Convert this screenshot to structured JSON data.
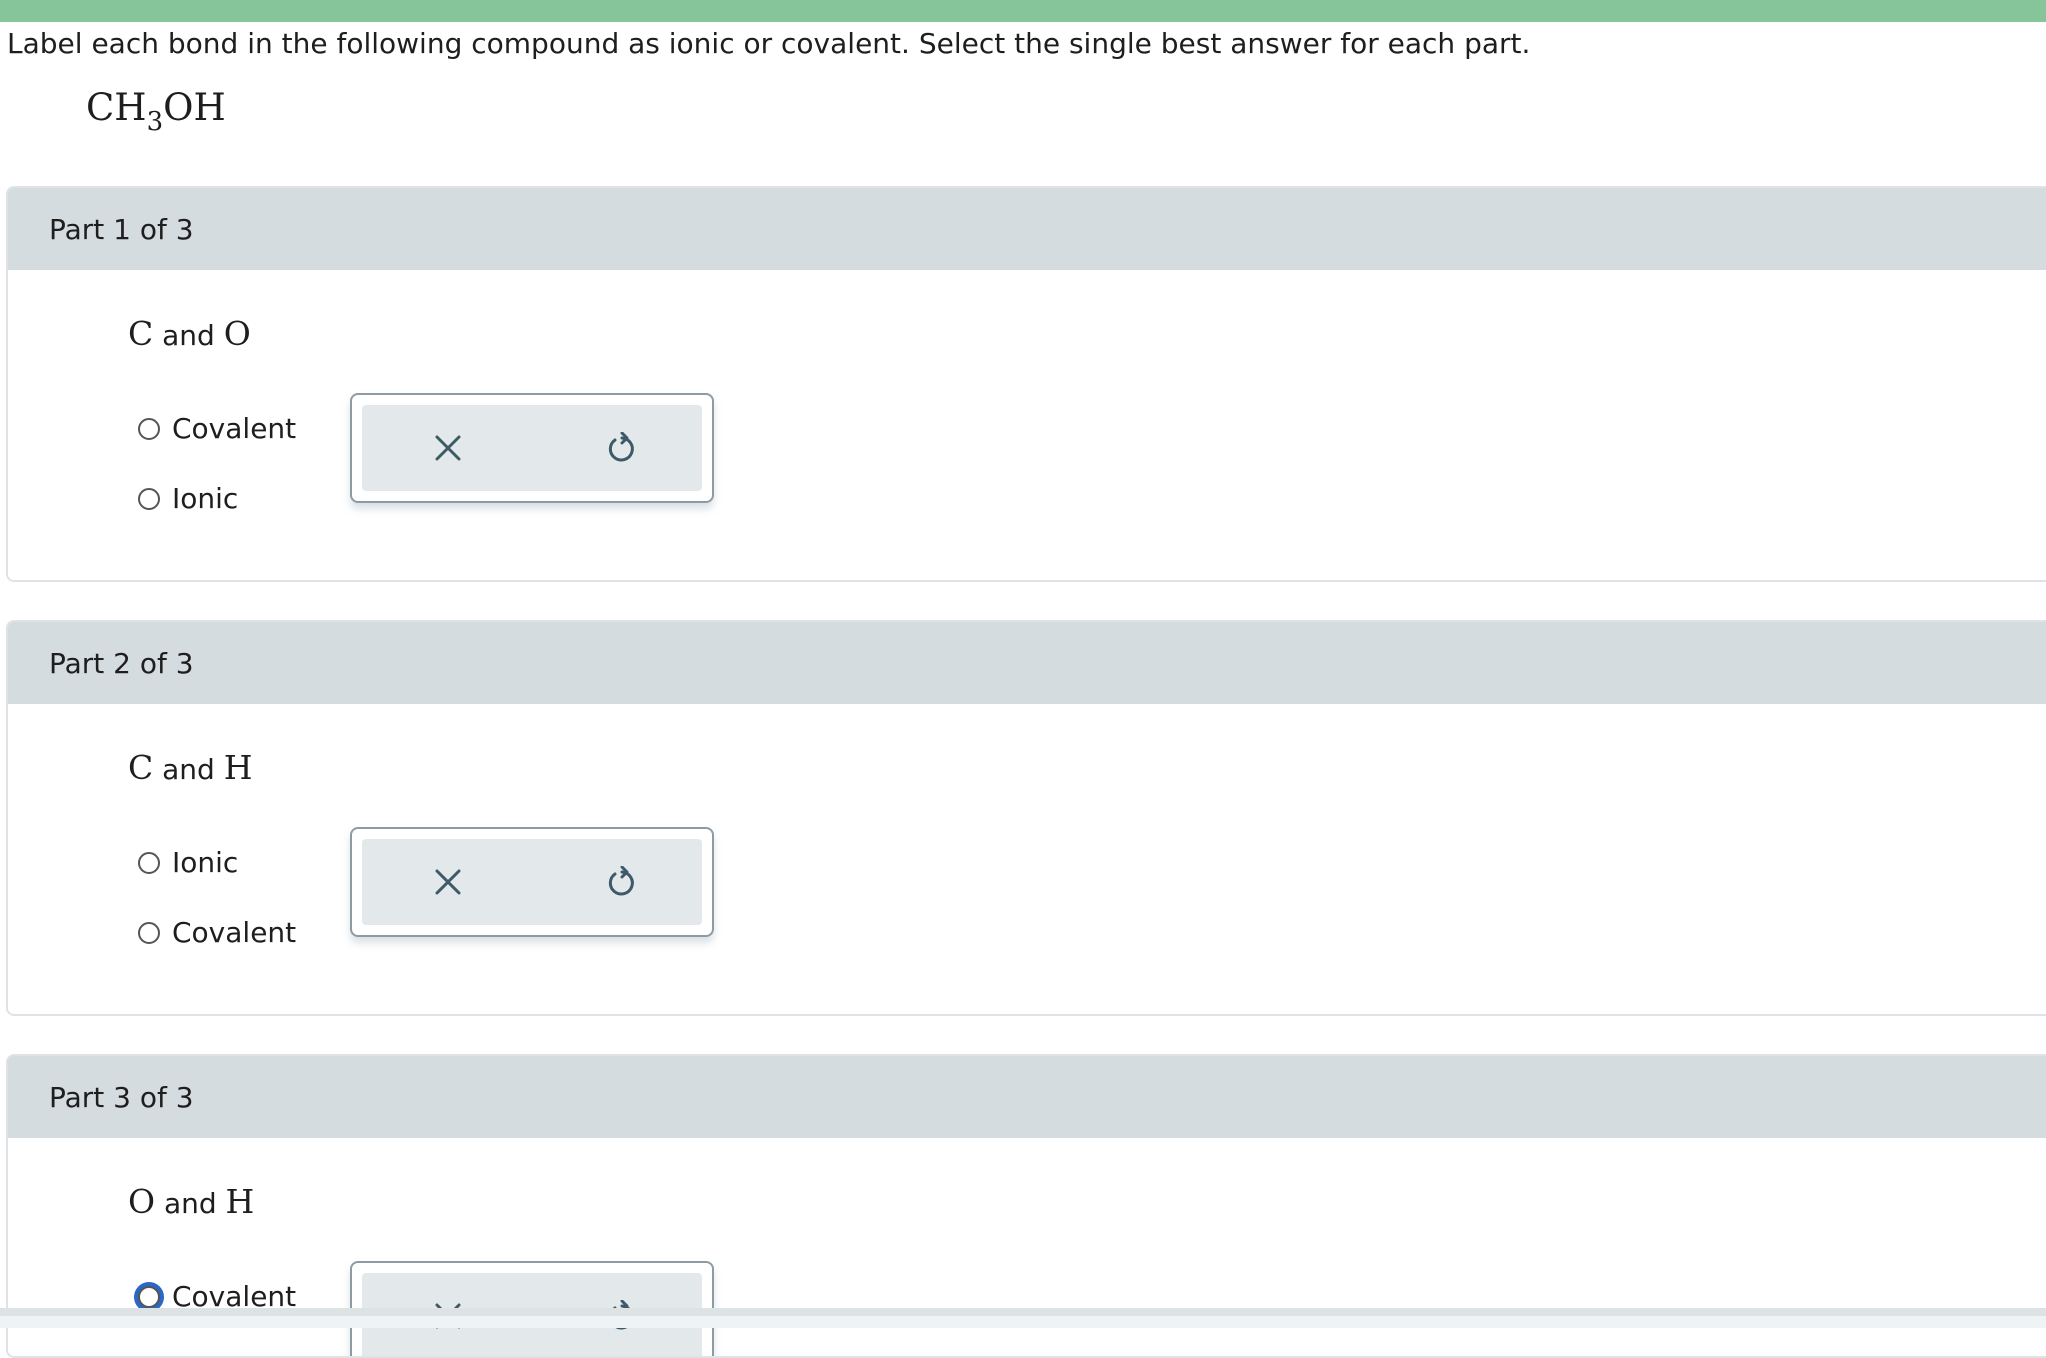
{
  "prompt": "Label each bond in the following compound as ionic or covalent. Select the single best answer for each part.",
  "formula": {
    "main": "CH",
    "subscript": "3",
    "tail": "OH"
  },
  "parts": [
    {
      "header": "Part 1 of 3",
      "question": {
        "el1": "C",
        "and": " and ",
        "el2": "O"
      },
      "options": [
        "Covalent",
        "Ionic"
      ]
    },
    {
      "header": "Part 2 of 3",
      "question": {
        "el1": "C",
        "and": " and ",
        "el2": "H"
      },
      "options": [
        "Ionic",
        "Covalent"
      ]
    },
    {
      "header": "Part 3 of 3",
      "question": {
        "el1": "O",
        "and": " and ",
        "el2": "H"
      },
      "options": [
        "Covalent"
      ]
    }
  ],
  "icons": {
    "clear": "close-icon",
    "reset": "undo-icon"
  },
  "colors": {
    "top_bar": "#86c49a",
    "header_bg": "#d5dce0",
    "focus": "#2b67c6",
    "icon": "#3e5a68"
  }
}
